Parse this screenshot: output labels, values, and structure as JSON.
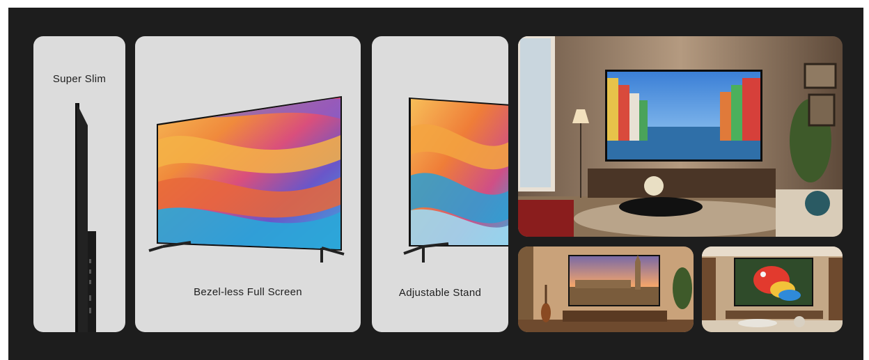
{
  "features": [
    {
      "label": "Super Slim",
      "icon": "tv-side-profile"
    },
    {
      "label": "Bezel-less Full Screen",
      "icon": "tv-front-view"
    },
    {
      "label": "Adjustable Stand",
      "icon": "tv-stand-closeup"
    }
  ],
  "lifestyle_photos": [
    {
      "scene": "living-room-tv-italian-canal"
    },
    {
      "scene": "room-tv-london-skyline"
    },
    {
      "scene": "room-tv-parrot"
    }
  ],
  "colors": {
    "background": "#1d1d1d",
    "card": "#dcdcdc",
    "text": "#1e1e1e"
  }
}
